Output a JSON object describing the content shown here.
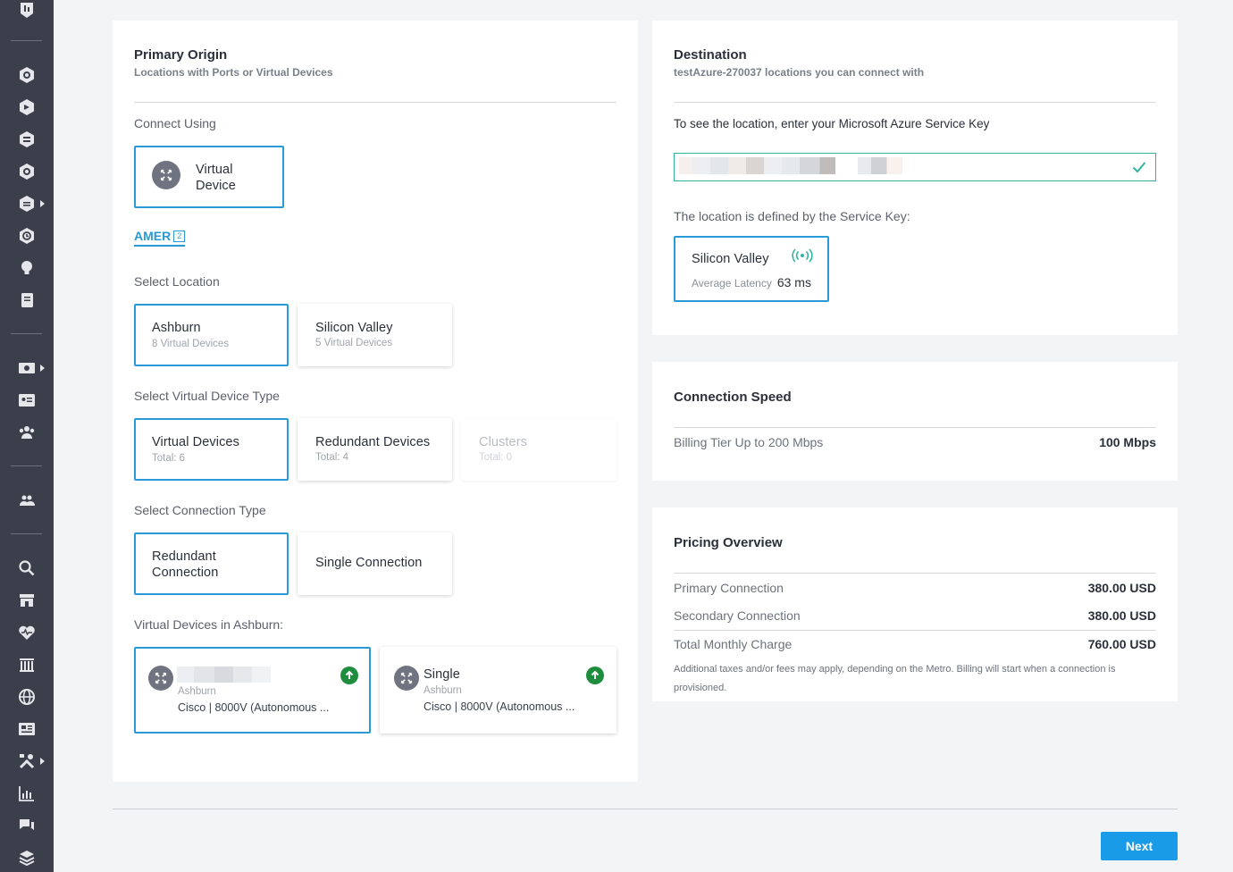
{
  "primary_origin": {
    "title": "Primary Origin",
    "subtitle": "Locations with Ports or Virtual Devices",
    "connect_using_label": "Connect Using",
    "connect_using_option": [
      "Virtual",
      "Device"
    ],
    "region_tab": "AMER",
    "region_count": "2",
    "select_location_label": "Select Location",
    "locations": [
      {
        "name": "Ashburn",
        "detail": "8 Virtual Devices",
        "selected": true
      },
      {
        "name": "Silicon Valley",
        "detail": "5 Virtual Devices",
        "selected": false
      }
    ],
    "device_type_label": "Select Virtual Device Type",
    "device_types": [
      {
        "name": "Virtual Devices",
        "detail": "Total: 6",
        "selected": true
      },
      {
        "name": "Redundant Devices",
        "detail": "Total: 4",
        "selected": false
      },
      {
        "name": "Clusters",
        "detail": "Total: 0",
        "disabled": true
      }
    ],
    "connection_type_label": "Select Connection Type",
    "connection_types": [
      {
        "name": "Redundant Connection",
        "selected": true
      },
      {
        "name": "Single Connection",
        "selected": false
      }
    ],
    "devices_in_label": "Virtual Devices in Ashburn:",
    "devices": [
      {
        "name": "",
        "location": "Ashburn",
        "model": "Cisco | 8000V (Autonomous ...",
        "selected": true
      },
      {
        "name": "Single",
        "location": "Ashburn",
        "model": "Cisco | 8000V (Autonomous ...",
        "selected": false
      }
    ]
  },
  "destination": {
    "title": "Destination",
    "subtitle": "testAzure-270037 locations you can connect with",
    "service_key_prompt": "To see the location, enter your Microsoft Azure Service Key",
    "location_defined_label": "The location is defined by the Service Key:",
    "location": {
      "name": "Silicon Valley",
      "latency_label": "Average Latency",
      "latency_value": "63 ms"
    }
  },
  "connection_speed": {
    "title": "Connection Speed",
    "tier_label": "Billing Tier Up to 200 Mbps",
    "tier_value": "100 Mbps"
  },
  "pricing": {
    "title": "Pricing Overview",
    "rows": [
      {
        "label": "Primary Connection",
        "value": "380.00 USD"
      },
      {
        "label": "Secondary Connection",
        "value": "380.00 USD"
      },
      {
        "label": "Total Monthly Charge",
        "value": "760.00 USD"
      }
    ],
    "note": "Additional taxes and/or fees may apply, depending on the Metro. Billing will start when a connection is provisioned."
  },
  "footer": {
    "next_label": "Next"
  },
  "colors": {
    "accent": "#2a9ad6",
    "button": "#1a9be8",
    "success": "#1e8e3e",
    "sidebar": "#3a3f4b"
  },
  "sidebar_icons": [
    "dashboard-icon",
    "cube-icon",
    "network-icon",
    "stack-icon",
    "hexagon-icon",
    "server-icon",
    "clock-icon",
    "lightbulb-icon",
    "notebook-icon",
    "billing-icon",
    "id-card-icon",
    "users-icon",
    "team-icon",
    "search-icon",
    "marketplace-icon",
    "health-icon",
    "datacenter-icon",
    "globe-icon",
    "news-icon",
    "tools-icon",
    "chart-icon",
    "chat-icon",
    "layers-icon"
  ]
}
